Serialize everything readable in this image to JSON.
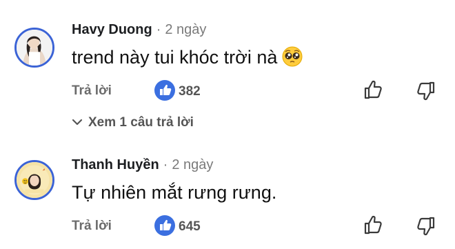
{
  "comments": [
    {
      "author": "Havy Duong",
      "separator": "·",
      "time": "2 ngày",
      "text": "trend này tui khóc trời nà",
      "emoji": "pleading-face-emoji",
      "reply_label": "Trả lời",
      "like_count": "382"
    },
    {
      "author": "Thanh Huyền",
      "separator": "·",
      "time": "2 ngày",
      "text": "Tự nhiên mắt rưng rưng.",
      "reply_label": "Trả lời",
      "like_count": "645"
    }
  ],
  "view_replies_label": "Xem 1 câu trả lời",
  "colors": {
    "like_blue": "#3b6fe0",
    "avatar_ring": "#3b63d6",
    "muted_text": "#6b6b6b"
  }
}
